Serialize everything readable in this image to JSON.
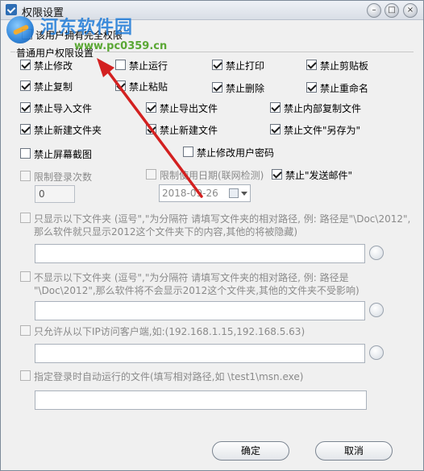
{
  "window": {
    "title": "权限设置"
  },
  "watermark": {
    "name": "河东软件园",
    "url": "www.pc0359.cn"
  },
  "top_option": {
    "label": "该用户拥有完全权限",
    "checked": false
  },
  "group_label": "普通用户权限设置",
  "perms_row1": [
    {
      "label": "禁止修改",
      "checked": true
    },
    {
      "label": "禁止运行",
      "checked": false
    },
    {
      "label": "禁止打印",
      "checked": true
    },
    {
      "label": "禁止剪贴板",
      "checked": true
    }
  ],
  "perms_row2": [
    {
      "label": "禁止复制",
      "checked": true
    },
    {
      "label": "禁止粘贴",
      "checked": true
    },
    {
      "label": "禁止删除",
      "checked": true
    },
    {
      "label": "禁止重命名",
      "checked": true
    }
  ],
  "perms_row3": [
    {
      "label": "禁止导入文件",
      "checked": true
    },
    {
      "label": "禁止导出文件",
      "checked": true
    },
    {
      "label": "禁止内部复制文件",
      "checked": true
    }
  ],
  "perms_row4": [
    {
      "label": "禁止新建文件夹",
      "checked": true
    },
    {
      "label": "禁止新建文件",
      "checked": true
    },
    {
      "label": "禁止文件\"另存为\"",
      "checked": true
    }
  ],
  "perms_row5": [
    {
      "label": "禁止屏幕截图",
      "checked": false
    },
    {
      "label": "禁止修改用户密码",
      "checked": false
    }
  ],
  "login_limit": {
    "label": "限制登录次数",
    "value": "0"
  },
  "date_limit": {
    "label": "限制使用日期(联网检测)",
    "value": "2018-09-26"
  },
  "no_email": {
    "label": "禁止\"发送邮件\"",
    "checked": true
  },
  "show_folders": {
    "line1": "只显示以下文件夹 (逗号\",\"为分隔符 请填写文件夹的相对路径, 例: 路径是\"\\Doc\\2012\",",
    "line2": "那么软件就只显示2012这个文件夹下的内容,其他的将被隐藏)",
    "value": ""
  },
  "hide_folders": {
    "line1": "不显示以下文件夹 (逗号\",\"为分隔符 请填写文件夹的相对路径, 例: 路径是",
    "line2": "\"\\Doc\\2012\",那么软件将不会显示2012这个文件夹,其他的文件夹不受影响)",
    "value": ""
  },
  "ip_allow": {
    "label": "只允许从以下IP访问客户端,如:(192.168.1.15,192.168.5.63)",
    "value": ""
  },
  "autorun": {
    "label": "指定登录时自动运行的文件(填写相对路径,如 \\test1\\msn.exe)",
    "value": ""
  },
  "buttons": {
    "ok": "确定",
    "cancel": "取消"
  }
}
